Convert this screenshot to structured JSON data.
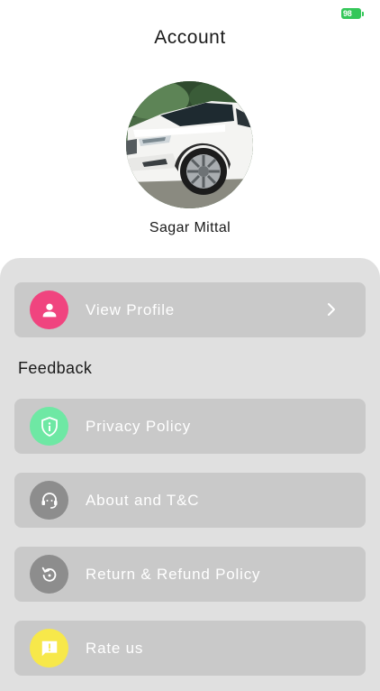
{
  "status_bar": {
    "battery_level": "98",
    "battery_color": "#34c759"
  },
  "header": {
    "title": "Account"
  },
  "profile": {
    "name": "Sagar Mittal",
    "avatar_icon": "car-photo"
  },
  "menu": {
    "view_profile": {
      "label": "View Profile",
      "icon": "person-icon",
      "icon_color": "#f0447f"
    },
    "feedback_section_title": "Feedback",
    "items": [
      {
        "label": "Privacy Policy",
        "icon": "shield-info-icon",
        "icon_color": "#6ee8a4"
      },
      {
        "label": "About and T&C",
        "icon": "support-agent-icon",
        "icon_color": "#8d8d8d"
      },
      {
        "label": "Return & Refund Policy",
        "icon": "refresh-icon",
        "icon_color": "#8d8d8d"
      },
      {
        "label": "Rate us",
        "icon": "feedback-icon",
        "icon_color": "#f7e84a"
      }
    ]
  },
  "colors": {
    "sheet_background": "#e0e0e0",
    "item_background": "#c9c9c9",
    "item_text": "#ffffff"
  }
}
